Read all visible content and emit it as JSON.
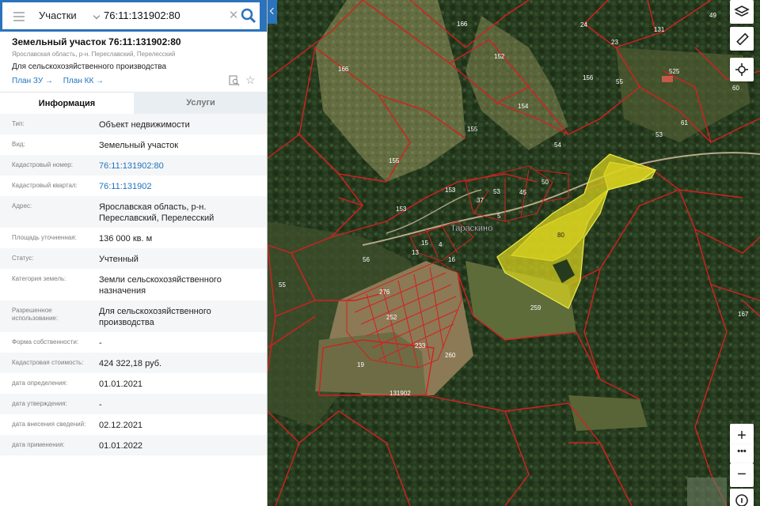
{
  "search": {
    "layer": "Участки",
    "query": "76:11:131902:80",
    "clear_icon": "close-icon",
    "search_icon": "search-icon"
  },
  "parcel": {
    "title": "Земельный участок 76:11:131902:80",
    "region": "Ярославская область, р-н. Переславский, Перелесский",
    "use": "Для сельскохозяйственного производства",
    "link_zu": "План ЗУ →",
    "link_kk": "План КК →"
  },
  "tabs": {
    "info": "Информация",
    "services": "Услуги"
  },
  "info_rows": [
    {
      "key": "Тип:",
      "value": "Объект недвижимости"
    },
    {
      "key": "Вид:",
      "value": "Земельный участок"
    },
    {
      "key": "Кадастровый номер:",
      "value": "76:11:131902:80"
    },
    {
      "key": "Кадастровый квартал:",
      "value": "76:11:131902"
    },
    {
      "key": "Адрес:",
      "value": "Ярославская область, р-н. Переславский, Перелесский"
    },
    {
      "key": "Площадь уточненная:",
      "value": "136 000 кв. м"
    },
    {
      "key": "Статус:",
      "value": "Учтенный"
    },
    {
      "key": "Категория земель:",
      "value": "Земли сельскохозяйственного назначения"
    },
    {
      "key": "Разрешенное использование:",
      "value": "Для сельскохозяйственного производства"
    },
    {
      "key": "Форма собственности:",
      "value": "-"
    },
    {
      "key": "Кадастровая стоимость:",
      "value": "424 322,18 руб."
    },
    {
      "key": "дата определения:",
      "value": "01.01.2021"
    },
    {
      "key": "дата утверждения:",
      "value": "-"
    },
    {
      "key": "дата внесения сведений:",
      "value": "02.12.2021"
    },
    {
      "key": "дата применения:",
      "value": "01.01.2022"
    }
  ],
  "map": {
    "village": "Тараскино",
    "labels": [
      "166",
      "166",
      "152",
      "156",
      "154",
      "155",
      "155",
      "153",
      "153",
      "37",
      "53",
      "50",
      "80",
      "56",
      "55",
      "259",
      "260",
      "19",
      "131902",
      "24",
      "23",
      "55",
      "525",
      "53",
      "54",
      "60",
      "49",
      "15",
      "16",
      "4",
      "13",
      "5",
      "45",
      "276",
      "252",
      "233",
      "61",
      "167",
      "131"
    ],
    "zoom_in": "+",
    "more": "•••",
    "zoom_out": "−",
    "colors": {
      "accent": "#2b73bb",
      "parcel_border": "#d42020",
      "selected_fill": "#d9d21e",
      "link": "#1e73be"
    }
  }
}
